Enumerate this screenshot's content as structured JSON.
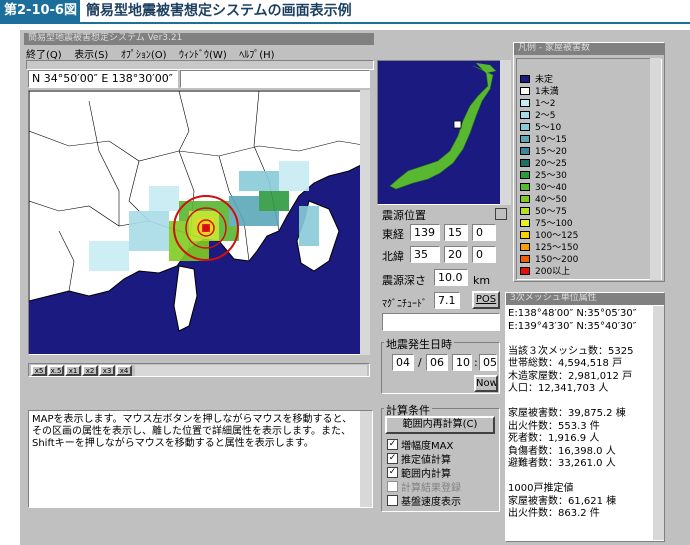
{
  "heading": {
    "badge": "第2-10-6図",
    "title": "簡易型地震被害想定システムの画面表示例"
  },
  "window": {
    "title": "簡易型地震被害想定システム Ver3.21"
  },
  "menu": [
    "終了(Q)",
    "表示(S)",
    "ｵﾌﾟｼｮﾝ(O)",
    "ｳｨﾝﾄﾞｳ(W)",
    "ﾍﾙﾌﾟ(H)"
  ],
  "coords": {
    "value": "N 34°50′00″ E 138°30′00″"
  },
  "zoom_buttons": [
    "x5",
    "x.5",
    "x1",
    "x2",
    "x3",
    "x4"
  ],
  "epicenter": {
    "title": "震源位置",
    "lon_label": "東経",
    "lon": [
      "139",
      "15",
      "0"
    ],
    "lat_label": "北緯",
    "lat": [
      "35",
      "20",
      "0"
    ],
    "depth_label": "震源深さ",
    "depth": "10.0",
    "depth_unit": "km",
    "magnitude_label": "ﾏｸﾞﾆﾁｭｰﾄﾞ",
    "magnitude": "7.1",
    "pos_button": "POS"
  },
  "datetime": {
    "title": "地震発生日時",
    "month": "04",
    "day": "06",
    "hour": "10",
    "minute": "05",
    "sep1": "/",
    "sep2": ":",
    "now_button": "Now"
  },
  "calc": {
    "title": "計算条件",
    "range_button": "範囲内再計算(C)",
    "options": [
      {
        "label": "増幅度MAX",
        "checked": true,
        "enabled": true
      },
      {
        "label": "推定値計算",
        "checked": true,
        "enabled": true
      },
      {
        "label": "範囲内計算",
        "checked": true,
        "enabled": true
      },
      {
        "label": "計算結果登録",
        "checked": false,
        "enabled": false
      },
      {
        "label": "基盤速度表示",
        "checked": false,
        "enabled": true
      }
    ]
  },
  "message": "MAPを表示します。マウス左ボタンを押しながらマウスを移動すると、その区画の属性を表示し、離した位置で詳細属性を表示します。また、Shiftキーを押しながらマウスを移動すると属性を表示します。",
  "legend": {
    "title": "凡例 - 家屋被害数",
    "items": [
      {
        "label": "未定",
        "color": "#1a1a80"
      },
      {
        "label": "1未満",
        "color": "#ffffff"
      },
      {
        "label": "1～2",
        "color": "#c8ecf4"
      },
      {
        "label": "2～5",
        "color": "#a8dce8"
      },
      {
        "label": "5～10",
        "color": "#88ccd8"
      },
      {
        "label": "10～15",
        "color": "#5aa8b8"
      },
      {
        "label": "15～20",
        "color": "#3c8898"
      },
      {
        "label": "20～25",
        "color": "#1e7060"
      },
      {
        "label": "25～30",
        "color": "#2e9a40"
      },
      {
        "label": "30～40",
        "color": "#58b830"
      },
      {
        "label": "40～50",
        "color": "#80cc20"
      },
      {
        "label": "50～75",
        "color": "#b8e020"
      },
      {
        "label": "75～100",
        "color": "#e8f020"
      },
      {
        "label": "100～125",
        "color": "#f8d000"
      },
      {
        "label": "125～150",
        "color": "#f8a000"
      },
      {
        "label": "150～200",
        "color": "#f06000"
      },
      {
        "label": "200以上",
        "color": "#e01010"
      }
    ]
  },
  "mesh": {
    "title": "3次メッシュ単位属性",
    "lines": [
      "E:138°48′00″ N:35°05′30″",
      "E:139°43′30″ N:35°40′30″",
      "",
      "当該３次メッシュ数：5325",
      "世帯総数：4,594,518 戸",
      "木造家屋数：2,981,012 戸",
      "人口：12,341,703 人",
      "",
      "家屋被害数：39,875.2 棟",
      "出火件数：553.3 件",
      "死者数：1,916.9 人",
      "負傷者数：16,398.0 人",
      "避難者数：33,261.0 人",
      "",
      "1000戸推定値",
      "家屋被害数：61,621 棟",
      "出火件数：863.2 件"
    ]
  },
  "colors": {
    "sea": "#1a1a80",
    "land": "#ffffff",
    "panel": "#c0c0c0",
    "accent": "#1c6f9a",
    "ring": "#d01010"
  }
}
